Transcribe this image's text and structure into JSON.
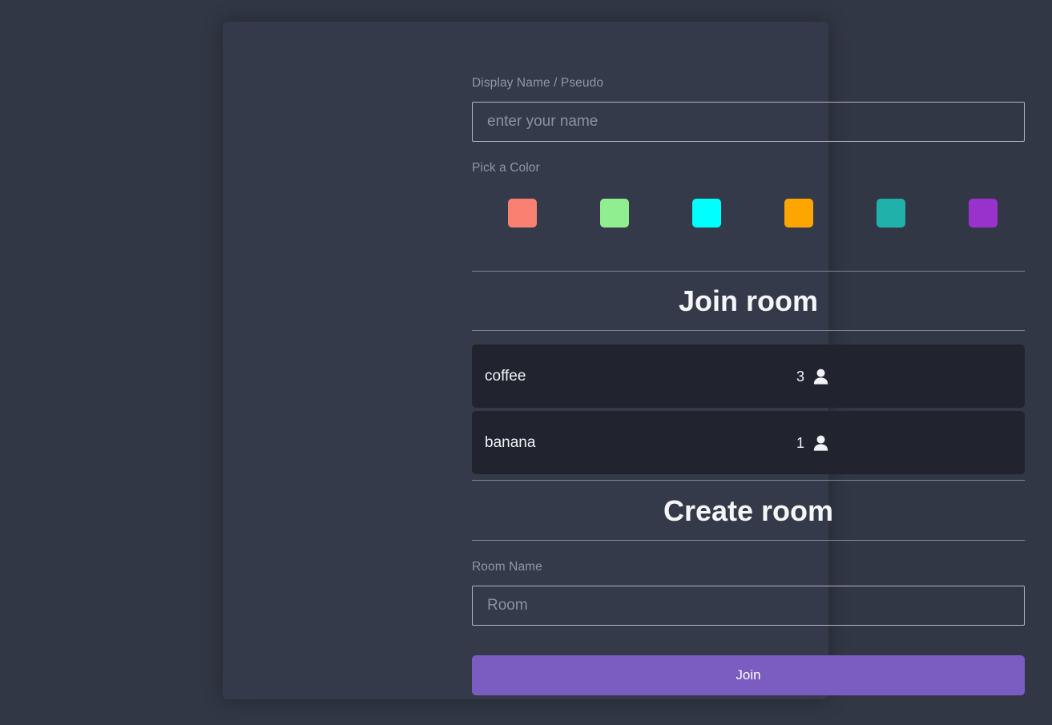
{
  "theme": {
    "page_background": "#323745",
    "card_background": "#343a4a",
    "room_row_background": "#21242f",
    "divider_color": "#7f8593",
    "label_color": "#9096a3",
    "text_color": "#f0f2f5",
    "accent_button": "#7b5dc2"
  },
  "display_name": {
    "label": "Display Name / Pseudo",
    "placeholder": "enter your name",
    "value": ""
  },
  "color_picker": {
    "label": "Pick a Color",
    "swatches": [
      {
        "name": "salmon",
        "hex": "#fa8072"
      },
      {
        "name": "light-green",
        "hex": "#90ee90"
      },
      {
        "name": "cyan",
        "hex": "#00ffff"
      },
      {
        "name": "orange",
        "hex": "#ffa500"
      },
      {
        "name": "light-sea-green",
        "hex": "#20b2aa"
      },
      {
        "name": "dark-orchid",
        "hex": "#9932cc"
      }
    ]
  },
  "join_section": {
    "title": "Join room",
    "rooms": [
      {
        "name": "coffee",
        "count": "3",
        "icon": "person-icon"
      },
      {
        "name": "banana",
        "count": "1",
        "icon": "person-icon"
      }
    ]
  },
  "create_section": {
    "title": "Create room",
    "room_name": {
      "label": "Room Name",
      "placeholder": "Room",
      "value": ""
    }
  },
  "actions": {
    "join_label": "Join"
  }
}
